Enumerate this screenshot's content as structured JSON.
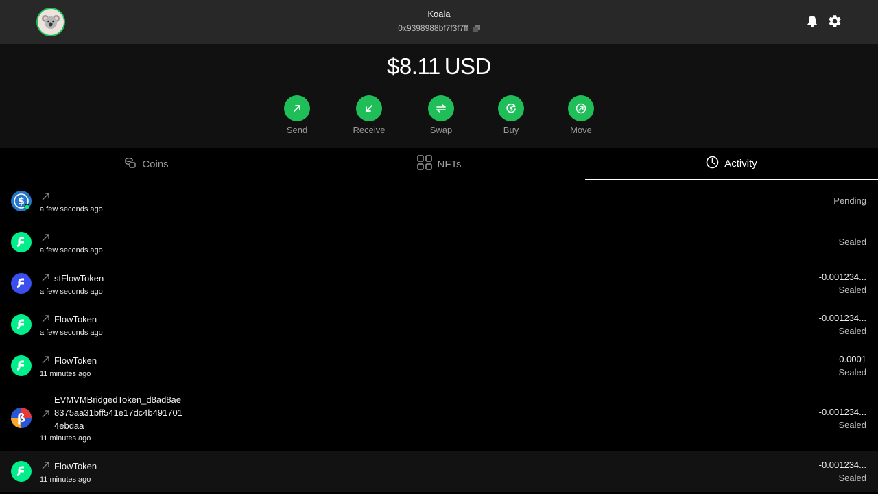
{
  "header": {
    "account_name": "Koala",
    "account_address": "0x9398988bf7f3f7ff"
  },
  "balance": {
    "amount": "$8.11",
    "currency": "USD"
  },
  "actions": [
    {
      "label": "Send",
      "icon": "arrow-up-right-icon"
    },
    {
      "label": "Receive",
      "icon": "arrow-down-left-icon"
    },
    {
      "label": "Swap",
      "icon": "swap-icon"
    },
    {
      "label": "Buy",
      "icon": "buy-icon"
    },
    {
      "label": "Move",
      "icon": "move-icon"
    }
  ],
  "tabs": [
    {
      "label": "Coins",
      "icon": "coins-icon",
      "active": false
    },
    {
      "label": "NFTs",
      "icon": "grid-icon",
      "active": false
    },
    {
      "label": "Activity",
      "icon": "clock-icon",
      "active": true
    }
  ],
  "activity": [
    {
      "token_icon": "usdc-icon",
      "name": "",
      "time": "a few seconds ago",
      "amount": "",
      "status": "Pending"
    },
    {
      "token_icon": "flow-icon",
      "name": "",
      "time": "a few seconds ago",
      "amount": "",
      "status": "Sealed"
    },
    {
      "token_icon": "stflow-icon",
      "name": "stFlowToken",
      "time": "a few seconds ago",
      "amount": "-0.001234...",
      "status": "Sealed"
    },
    {
      "token_icon": "flow-icon",
      "name": "FlowToken",
      "time": "a few seconds ago",
      "amount": "-0.001234...",
      "status": "Sealed"
    },
    {
      "token_icon": "flow-icon",
      "name": "FlowToken",
      "time": "11 minutes ago",
      "amount": "-0.0001",
      "status": "Sealed"
    },
    {
      "token_icon": "beta-icon",
      "name": "EVMVMBridgedToken_d8ad8ae\n8375aa31bff541e17dc4b491701\n4ebdaa",
      "time": "11 minutes ago",
      "amount": "-0.001234...",
      "status": "Sealed"
    },
    {
      "token_icon": "flow-icon",
      "name": "FlowToken",
      "time": "11 minutes ago",
      "amount": "-0.001234...",
      "status": "Sealed"
    }
  ],
  "colors": {
    "accent": "#1fbe59",
    "header_bg": "#282828",
    "balance_bg": "#111111",
    "flow_green": "#00ef8b",
    "stflow_blue": "#3b4ef0",
    "usdc_blue": "#2775ca"
  }
}
